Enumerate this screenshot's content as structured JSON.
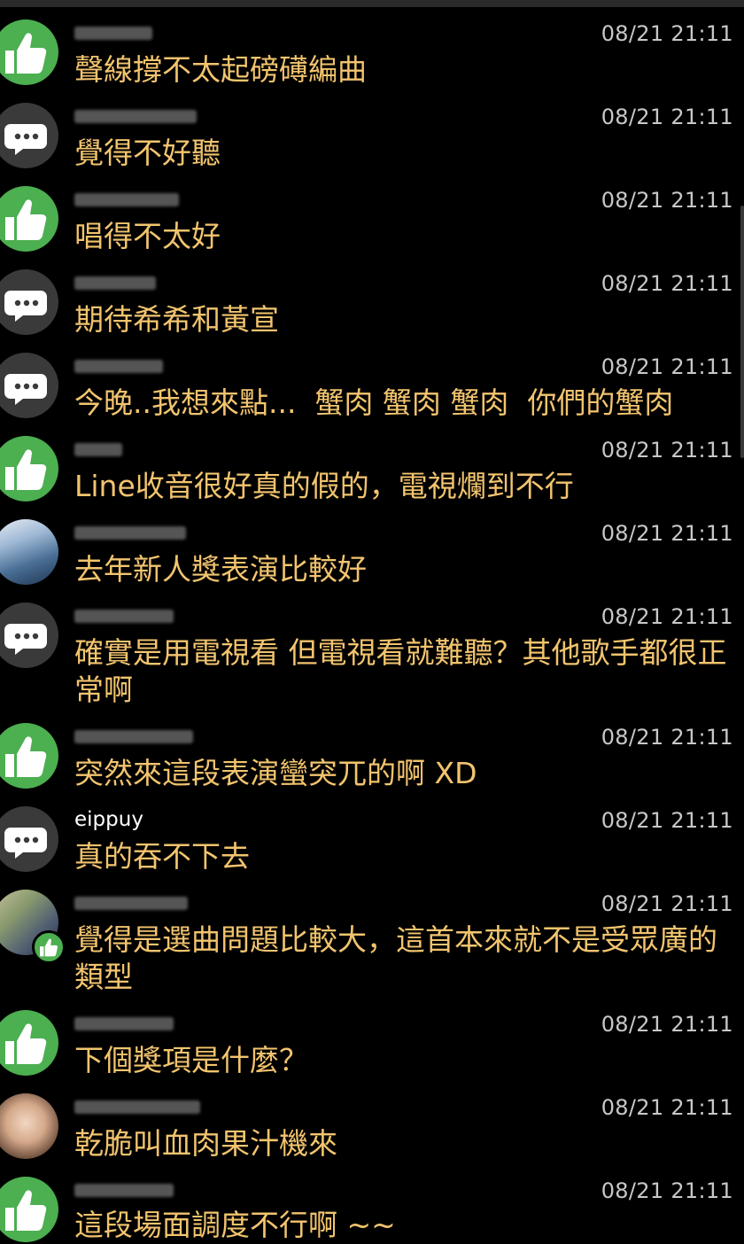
{
  "ui": {
    "time_color": "#c8c8c8",
    "message_color": "#f2c46e",
    "like_icon_bg": "#4caf50",
    "comment_icon_bg": "#3a3a3a"
  },
  "messages": [
    {
      "avatar": "like-icon",
      "name": "",
      "time": "08/21 21:11",
      "text": "聲線撐不太起磅礡編曲"
    },
    {
      "avatar": "comment-icon",
      "name": "",
      "time": "08/21 21:11",
      "text": "覺得不好聽"
    },
    {
      "avatar": "like-icon",
      "name": "",
      "time": "08/21 21:11",
      "text": "唱得不太好"
    },
    {
      "avatar": "comment-icon",
      "name": "",
      "time": "08/21 21:11",
      "text": "期待希希和黃宣"
    },
    {
      "avatar": "comment-icon",
      "name": "",
      "time": "08/21 21:11",
      "text": "今晚..我想來點...  蟹肉 蟹肉 蟹肉  你們的蟹肉"
    },
    {
      "avatar": "like-icon",
      "name": "",
      "time": "08/21 21:11",
      "text": "Line收音很好真的假的，電視爛到不行"
    },
    {
      "avatar": "profile-photo",
      "name": "",
      "time": "08/21 21:11",
      "text": "去年新人獎表演比較好"
    },
    {
      "avatar": "comment-icon",
      "name": "",
      "time": "08/21 21:11",
      "text": "確實是用電視看 但電視看就難聽？其他歌手都很正常啊"
    },
    {
      "avatar": "like-icon",
      "name": "",
      "time": "08/21 21:11",
      "text": "突然來這段表演蠻突兀的啊 XD"
    },
    {
      "avatar": "comment-icon",
      "name": "eippuy",
      "time": "08/21 21:11",
      "text": "真的吞不下去"
    },
    {
      "avatar": "profile-photo",
      "name": "",
      "time": "08/21 21:11",
      "text": "覺得是選曲問題比較大，這首本來就不是受眾廣的類型"
    },
    {
      "avatar": "like-icon",
      "name": "",
      "time": "08/21 21:11",
      "text": "下個獎項是什麼？"
    },
    {
      "avatar": "profile-photo",
      "name": "",
      "time": "08/21 21:11",
      "text": "乾脆叫血肉果汁機來"
    },
    {
      "avatar": "like-icon",
      "name": "",
      "time": "08/21 21:11",
      "text": "這段場面調度不行啊 ~~"
    }
  ]
}
